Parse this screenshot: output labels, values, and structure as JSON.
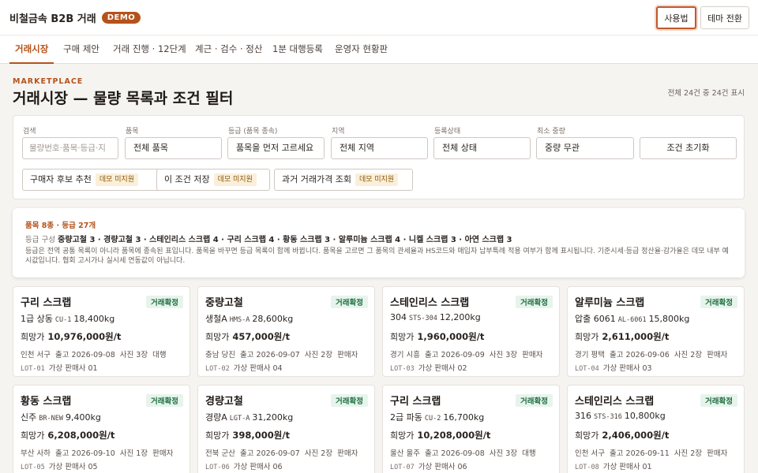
{
  "header": {
    "brand": "비철금속 B2B 거래",
    "badge": "DEMO",
    "help_label": "사용법",
    "theme_label": "테마 전환"
  },
  "tabs": [
    {
      "label": "거래시장"
    },
    {
      "label": "구매 제안"
    },
    {
      "label": "거래 진행 · 12단계"
    },
    {
      "label": "계근 · 검수 · 정산"
    },
    {
      "label": "1분 대행등록"
    },
    {
      "label": "운영자 현황판"
    }
  ],
  "section": {
    "kicker": "MARKETPLACE",
    "title": "거래시장 — 물량 목록과 조건 필터",
    "count": "전체 24건 중 24건 표시"
  },
  "filters": {
    "search": {
      "label": "검색",
      "placeholder": "물량번호·품목·등급·지"
    },
    "item": {
      "label": "품목",
      "value": "전체 품목"
    },
    "grade": {
      "label": "등급 (품목 종속)",
      "value": "품목을 먼저 고르세요"
    },
    "region": {
      "label": "지역",
      "value": "전체 지역"
    },
    "status": {
      "label": "등록상태",
      "value": "전체 상태"
    },
    "min_weight": {
      "label": "최소 중량",
      "value": "중량 무관"
    },
    "reset": "조건 초기화",
    "buyer_recommend": "구매자 후보 추천",
    "save_condition": "이 조건 저장",
    "past_price": "과거 거래가격 조회",
    "demo_tag": "데모 미지원"
  },
  "info": {
    "head": "품목 8종 · 등급 27개",
    "composition_label": "등급 구성",
    "composition": "중량고철 3 · 경량고철 3 · 스테인리스 스크랩 4 · 구리 스크랩 4 · 황동 스크랩 3 · 알루미늄 스크랩 4 · 니켈 스크랩 3 · 아연 스크랩 3",
    "desc": "등급은 전역 공통 목록이 아니라 품목에 종속된 표입니다. 품목을 바꾸면 등급 목록이 함께 바뀝니다. 품목을 고르면 그 품목의 관세율과 HS코드와 매입자 납부특례 적용 여부가 함께 표시됩니다. 기준시세·등급 정산율·감가율은 데모 내부 예시값입니다. 협회 고시가나 실시세 연동값이 아닙니다."
  },
  "price_label": "희망가",
  "cards": [
    {
      "title": "구리 스크랩",
      "status": "거래확정",
      "grade": "1급 상동",
      "code": "CU-1",
      "weight": "18,400kg",
      "price": "10,976,000원/t",
      "region": "인천 서구",
      "date": "출고 2026-09-08",
      "photos": "사진 3장",
      "seller_type": "대행",
      "lot": "LOT-01",
      "seller": "가상 판매사 01"
    },
    {
      "title": "중량고철",
      "status": "거래확정",
      "grade": "생철A",
      "code": "HMS-A",
      "weight": "28,600kg",
      "price": "457,000원/t",
      "region": "충남 당진",
      "date": "출고 2026-09-07",
      "photos": "사진 2장",
      "seller_type": "판매자",
      "lot": "LOT-02",
      "seller": "가상 판매사 04"
    },
    {
      "title": "스테인리스 스크랩",
      "status": "거래확정",
      "grade": "304",
      "code": "STS-304",
      "weight": "12,200kg",
      "price": "1,960,000원/t",
      "region": "경기 시흥",
      "date": "출고 2026-09-09",
      "photos": "사진 3장",
      "seller_type": "판매자",
      "lot": "LOT-03",
      "seller": "가상 판매사 02"
    },
    {
      "title": "알루미늄 스크랩",
      "status": "거래확정",
      "grade": "압출 6061",
      "code": "AL-6061",
      "weight": "15,800kg",
      "price": "2,611,000원/t",
      "region": "경기 평택",
      "date": "출고 2026-09-06",
      "photos": "사진 2장",
      "seller_type": "판매자",
      "lot": "LOT-04",
      "seller": "가상 판매사 03"
    },
    {
      "title": "황동 스크랩",
      "status": "거래확정",
      "grade": "신주",
      "code": "BR-NEW",
      "weight": "9,400kg",
      "price": "6,208,000원/t",
      "region": "부산 사하",
      "date": "출고 2026-09-10",
      "photos": "사진 1장",
      "seller_type": "판매자",
      "lot": "LOT-05",
      "seller": "가상 판매사 05"
    },
    {
      "title": "경량고철",
      "status": "거래확정",
      "grade": "경량A",
      "code": "LGT-A",
      "weight": "31,200kg",
      "price": "398,000원/t",
      "region": "전북 군산",
      "date": "출고 2026-09-07",
      "photos": "사진 2장",
      "seller_type": "판매자",
      "lot": "LOT-06",
      "seller": "가상 판매사 06"
    },
    {
      "title": "구리 스크랩",
      "status": "거래확정",
      "grade": "2급 파동",
      "code": "CU-2",
      "weight": "16,700kg",
      "price": "10,208,000원/t",
      "region": "울산 울주",
      "date": "출고 2026-09-08",
      "photos": "사진 3장",
      "seller_type": "대행",
      "lot": "LOT-07",
      "seller": "가상 판매사 06"
    },
    {
      "title": "스테인리스 스크랩",
      "status": "거래확정",
      "grade": "316",
      "code": "STS-316",
      "weight": "10,800kg",
      "price": "2,406,000원/t",
      "region": "인천 서구",
      "date": "출고 2026-09-11",
      "photos": "사진 2장",
      "seller_type": "판매자",
      "lot": "LOT-08",
      "seller": "가상 판매사 01"
    }
  ]
}
